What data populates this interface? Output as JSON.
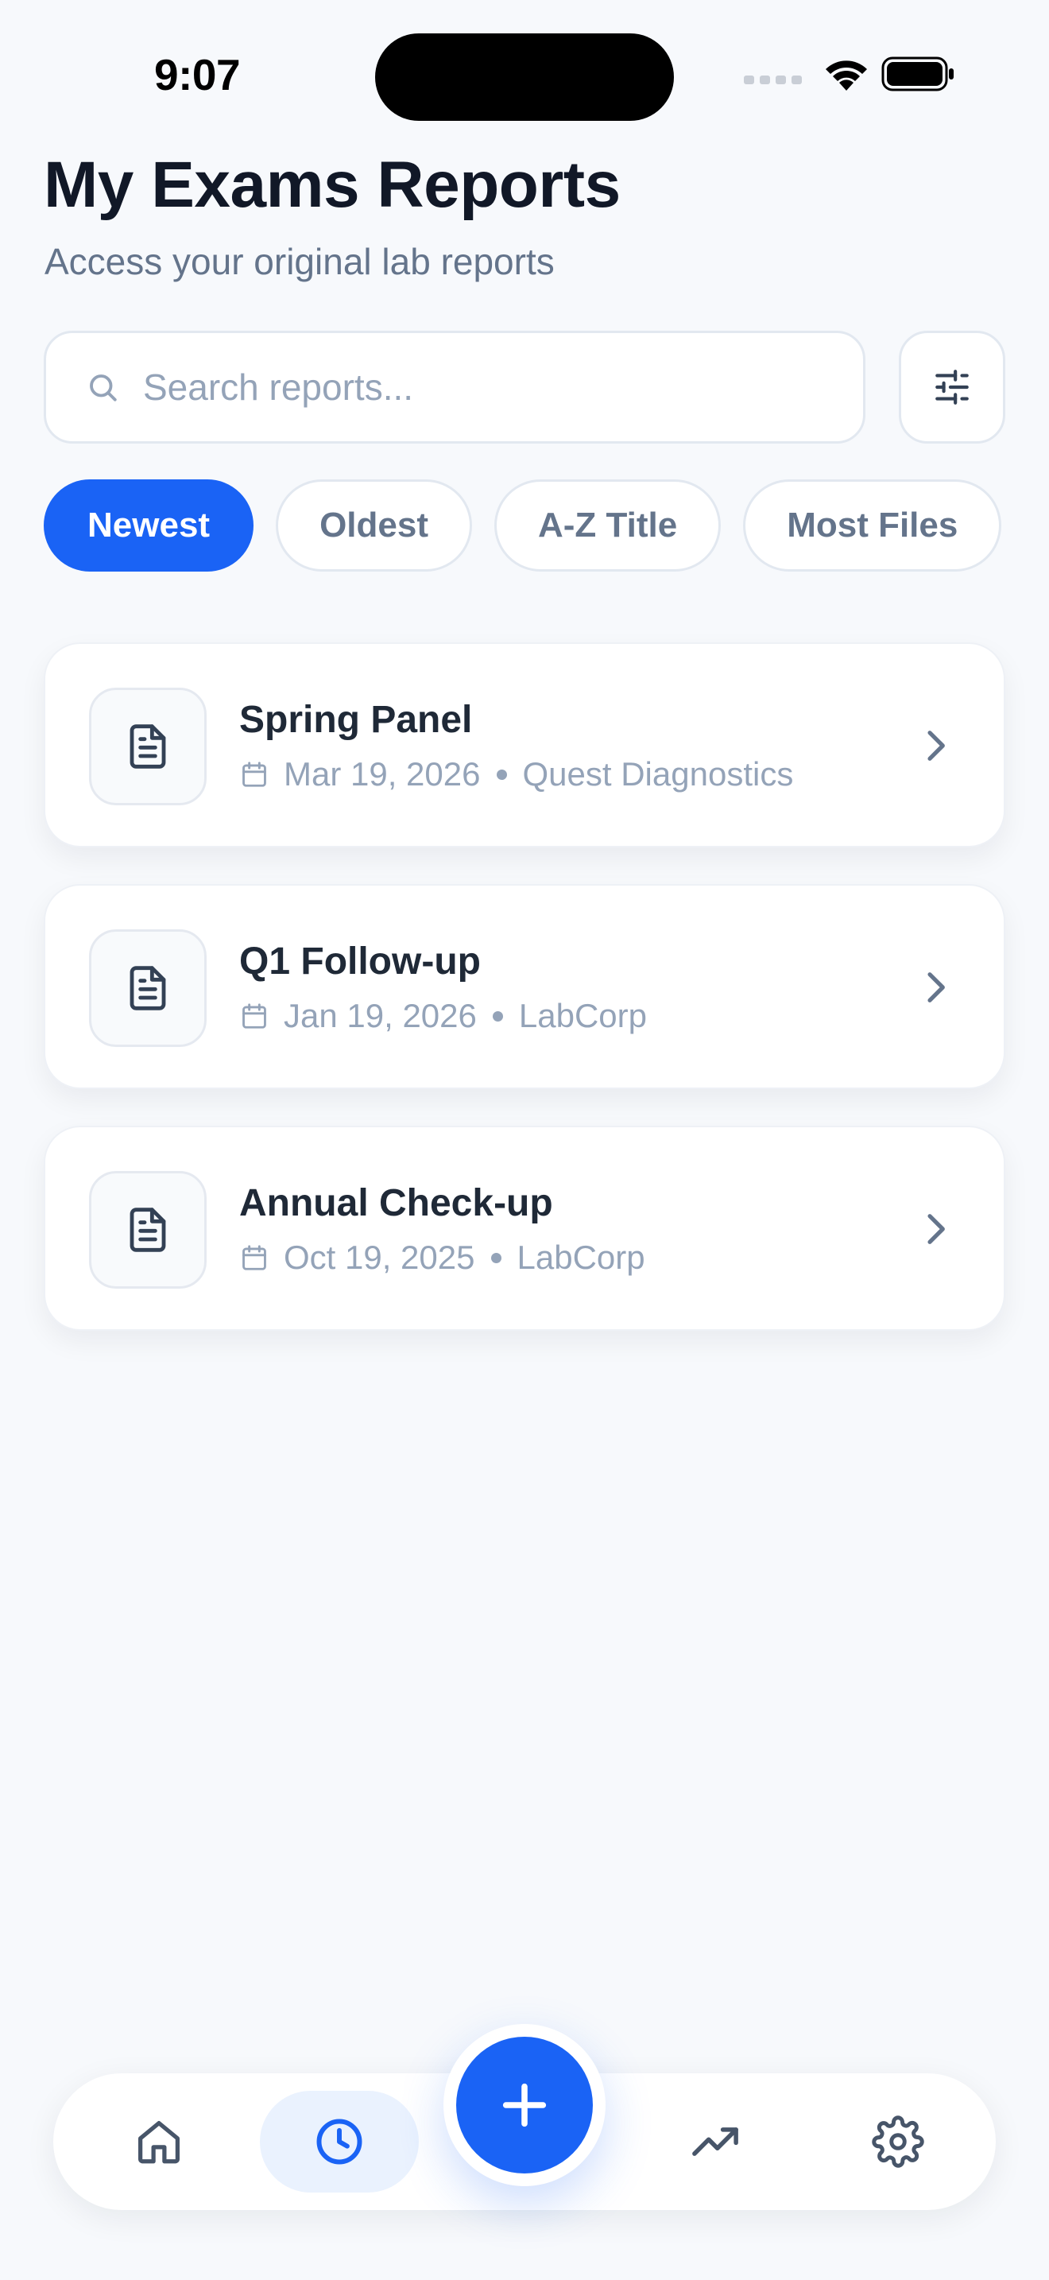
{
  "status_bar": {
    "time": "9:07"
  },
  "header": {
    "title": "My Exams Reports",
    "subtitle": "Access your original lab reports"
  },
  "search": {
    "placeholder": "Search reports...",
    "value": ""
  },
  "sort_chips": [
    {
      "label": "Newest",
      "active": true
    },
    {
      "label": "Oldest",
      "active": false
    },
    {
      "label": "A-Z Title",
      "active": false
    },
    {
      "label": "Most Files",
      "active": false
    }
  ],
  "reports": [
    {
      "title": "Spring Panel",
      "date": "Mar 19, 2026",
      "lab": "Quest Diagnostics"
    },
    {
      "title": "Q1 Follow-up",
      "date": "Jan 19, 2026",
      "lab": "LabCorp"
    },
    {
      "title": "Annual Check-up",
      "date": "Oct 19, 2025",
      "lab": "LabCorp"
    }
  ],
  "bottom_nav": {
    "items": [
      {
        "icon": "home-icon",
        "active": false
      },
      {
        "icon": "clock-icon",
        "active": true
      },
      {
        "icon": "plus-icon",
        "active": false
      },
      {
        "icon": "trending-up-icon",
        "active": false
      },
      {
        "icon": "gear-icon",
        "active": false
      }
    ]
  },
  "colors": {
    "accent": "#1a63f5",
    "background": "#f7f9fc",
    "title": "#111827",
    "muted": "#64748b",
    "meta": "#94a3b8"
  }
}
